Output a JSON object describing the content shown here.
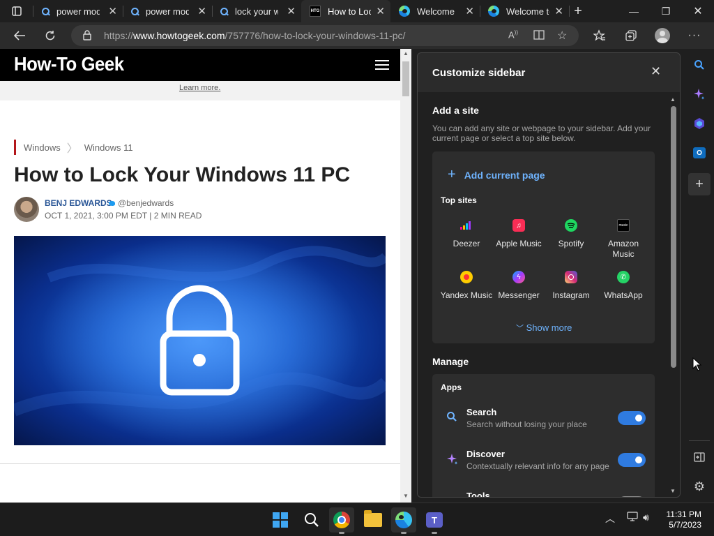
{
  "tabs": [
    {
      "title": "power mod",
      "icon": "search-icon",
      "active": false
    },
    {
      "title": "power mod",
      "icon": "search-icon",
      "active": false
    },
    {
      "title": "lock your w",
      "icon": "search-icon",
      "active": false
    },
    {
      "title": "How to Loc",
      "icon": "htg-favicon",
      "active": true
    },
    {
      "title": "Welcome",
      "icon": "edge-favicon",
      "active": false
    },
    {
      "title": "Welcome to",
      "icon": "edge-favicon",
      "active": false
    }
  ],
  "htg_favicon_text": "HTG",
  "address_bar": {
    "prefix": "https://",
    "domain": "www.howtogeek.com",
    "path": "/757776/how-to-lock-your-windows-11-pc/"
  },
  "page": {
    "site_logo": "How-To Geek",
    "ad_link": "Learn more.",
    "breadcrumb": [
      "Windows",
      "Windows 11"
    ],
    "title": "How to Lock Your Windows 11 PC",
    "author": "BENJ EDWARDS",
    "author_handle": "@benjedwards",
    "meta": "OCT 1, 2021, 3:00 PM EDT | 2 MIN READ"
  },
  "panel": {
    "title": "Customize sidebar",
    "add_site_heading": "Add a site",
    "add_site_description": "You can add any site or webpage to your sidebar. Add your current page or select a top site below.",
    "add_current_label": "Add current page",
    "top_sites_label": "Top sites",
    "top_sites": [
      {
        "name": "Deezer",
        "icon": "deezer-icon",
        "color": "#2b2b2b"
      },
      {
        "name": "Apple Music",
        "icon": "apple-music-icon",
        "color": "#fa2d55"
      },
      {
        "name": "Spotify",
        "icon": "spotify-icon",
        "color": "#1ed760"
      },
      {
        "name": "Amazon Music",
        "icon": "amazon-music-icon",
        "color": "#000000"
      },
      {
        "name": "Yandex Music",
        "icon": "yandex-music-icon",
        "color": "#ffcc00"
      },
      {
        "name": "Messenger",
        "icon": "messenger-icon",
        "color": "#a33bff"
      },
      {
        "name": "Instagram",
        "icon": "instagram-icon",
        "color": "#d6249f"
      },
      {
        "name": "WhatsApp",
        "icon": "whatsapp-icon",
        "color": "#25d366"
      }
    ],
    "show_more_label": "Show more",
    "manage_heading": "Manage",
    "apps_label": "Apps",
    "apps": [
      {
        "name": "Search",
        "description": "Search without losing your place",
        "enabled": true,
        "icon": "search-icon"
      },
      {
        "name": "Discover",
        "description": "Contextually relevant info for any page",
        "enabled": true,
        "icon": "discover-sparkle-icon"
      },
      {
        "name": "Tools",
        "description": "",
        "enabled": false,
        "icon": "tools-icon"
      }
    ]
  },
  "taskbar": {
    "time": "11:31 PM",
    "date": "5/7/2023"
  },
  "colors": {
    "accent": "#2f7be0",
    "link": "#6fb4ff",
    "brand_red": "#b3161a"
  }
}
